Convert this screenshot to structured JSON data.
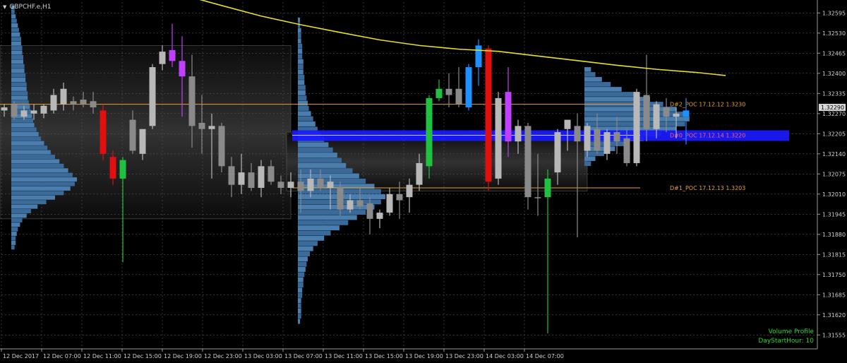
{
  "window": {
    "title": "GBPCHF.e,H1",
    "menu_icon": "triangle-down-icon"
  },
  "info_box": {
    "line1": "Volume Profile",
    "line2": "DayStartHour: 10"
  },
  "chart_data": {
    "type": "candlestick",
    "symbol": "GBPCHF.e",
    "timeframe": "H1",
    "ylim": [
      1.3151,
      1.3263
    ],
    "grid": true,
    "price_ticks": [
      "1.32595",
      "1.32530",
      "1.32465",
      "1.32400",
      "1.32335",
      "1.32270",
      "1.32205",
      "1.32140",
      "1.32075",
      "1.32010",
      "1.31945",
      "1.31880",
      "1.31815",
      "1.31750",
      "1.31685",
      "1.31620",
      "1.31555"
    ],
    "current_price": "1.32290",
    "time_labels": [
      "12 Dec 2017",
      "12 Dec 07:00",
      "12 Dec 11:00",
      "12 Dec 15:00",
      "12 Dec 19:00",
      "12 Dec 23:00",
      "13 Dec 03:00",
      "13 Dec 07:00",
      "13 Dec 11:00",
      "13 Dec 15:00",
      "13 Dec 19:00",
      "13 Dec 23:00",
      "14 Dec 03:00",
      "14 Dec 07:00"
    ],
    "poc_levels": [
      {
        "label": "D#2_POC 17.12.12 1.3230",
        "price": 1.323,
        "color": "#e8a030"
      },
      {
        "label": "D#0_POC 17.12.14 1.3220",
        "price": 1.322,
        "color": "#ff6060"
      },
      {
        "label": "D#1_POC 17.12.13 1.3203",
        "price": 1.3203,
        "color": "#e8a030"
      }
    ],
    "value_areas": [
      {
        "start": 0,
        "end": 29,
        "high": 1.3249,
        "low": 1.3193
      },
      {
        "start": 29,
        "end": 59,
        "high": 1.3221,
        "low": 1.3202
      }
    ],
    "volume_profiles": [
      {
        "anchor": 1,
        "high": 1.3262,
        "low": 1.3183,
        "poc": 1.323,
        "widths": [
          3,
          3,
          4,
          5,
          6,
          7,
          8,
          9,
          9,
          10,
          10,
          11,
          11,
          12,
          12,
          13,
          13,
          14,
          14,
          15,
          15,
          16,
          17,
          18,
          19,
          20,
          21,
          23,
          25,
          27,
          30,
          33,
          36,
          40,
          44,
          48,
          52,
          56,
          60,
          58,
          54,
          48,
          40,
          32,
          24,
          18,
          14,
          10,
          8,
          6,
          5,
          4,
          4,
          3
        ]
      },
      {
        "anchor": 30,
        "high": 1.3258,
        "low": 1.3159,
        "poc": 1.3203,
        "widths": [
          2,
          2,
          3,
          3,
          3,
          4,
          4,
          4,
          5,
          5,
          5,
          6,
          6,
          7,
          7,
          8,
          9,
          10,
          12,
          14,
          16,
          18,
          21,
          24,
          28,
          32,
          36,
          40,
          44,
          50,
          56,
          62,
          70,
          76,
          80,
          76,
          70,
          62,
          54,
          46,
          38,
          30,
          24,
          18,
          14,
          11,
          9,
          8,
          7,
          6,
          5,
          5,
          4,
          4,
          3,
          3,
          3,
          3,
          2
        ]
      },
      {
        "anchor": 59,
        "high": 1.3242,
        "low": 1.321,
        "poc": 1.322,
        "widths": [
          6,
          10,
          16,
          24,
          34,
          46,
          60,
          72,
          84,
          92,
          96,
          92,
          84,
          70,
          54,
          40,
          28,
          18,
          10,
          6
        ]
      }
    ],
    "series": [
      {
        "name": "MA",
        "type": "line",
        "color": "#e8e020"
      },
      {
        "name": "GBPCHF.e",
        "type": "candlestick"
      }
    ],
    "ma_values": [
      [
        14,
        1.32684
      ],
      [
        18,
        1.32654
      ],
      [
        22,
        1.32619
      ],
      [
        26,
        1.32585
      ],
      [
        30,
        1.32557
      ],
      [
        34,
        1.32532
      ],
      [
        38,
        1.32508
      ],
      [
        42,
        1.3249
      ],
      [
        46,
        1.32478
      ],
      [
        50,
        1.32471
      ],
      [
        54,
        1.32456
      ],
      [
        58,
        1.32441
      ],
      [
        62,
        1.32426
      ],
      [
        66,
        1.32413
      ],
      [
        70,
        1.32403
      ],
      [
        73,
        1.32393
      ]
    ],
    "candles": [
      {
        "i": 0,
        "o": 1.3228,
        "h": 1.323,
        "l": 1.3226,
        "c": 1.3229,
        "col": "#b8b8b8"
      },
      {
        "i": 1,
        "o": 1.323,
        "h": 1.3231,
        "l": 1.3225,
        "c": 1.3226,
        "col": "#8a8a8a"
      },
      {
        "i": 2,
        "o": 1.3226,
        "h": 1.32295,
        "l": 1.3225,
        "c": 1.3228,
        "col": "#b8b8b8"
      },
      {
        "i": 3,
        "o": 1.3228,
        "h": 1.323,
        "l": 1.3225,
        "c": 1.3227,
        "col": "#b8b8b8"
      },
      {
        "i": 4,
        "o": 1.3227,
        "h": 1.323,
        "l": 1.32255,
        "c": 1.32295,
        "col": "#b8b8b8"
      },
      {
        "i": 5,
        "o": 1.3228,
        "h": 1.3235,
        "l": 1.3227,
        "c": 1.3233,
        "col": "#b8b8b8"
      },
      {
        "i": 6,
        "o": 1.323,
        "h": 1.3237,
        "l": 1.3228,
        "c": 1.3235,
        "col": "#b8b8b8"
      },
      {
        "i": 7,
        "o": 1.323,
        "h": 1.32325,
        "l": 1.3228,
        "c": 1.3231,
        "col": "#8a8a8a"
      },
      {
        "i": 8,
        "o": 1.32315,
        "h": 1.3234,
        "l": 1.3229,
        "c": 1.323,
        "col": "#8a8a8a"
      },
      {
        "i": 9,
        "o": 1.3231,
        "h": 1.3234,
        "l": 1.3227,
        "c": 1.3229,
        "col": "#8a8a8a"
      },
      {
        "i": 10,
        "o": 1.3228,
        "h": 1.323,
        "l": 1.3212,
        "c": 1.3214,
        "col": "#e01010"
      },
      {
        "i": 11,
        "o": 1.3213,
        "h": 1.3215,
        "l": 1.3204,
        "c": 1.3206,
        "col": "#e01010"
      },
      {
        "i": 12,
        "o": 1.3206,
        "h": 1.3213,
        "l": 1.3179,
        "c": 1.3212,
        "col": "#20c040"
      },
      {
        "i": 13,
        "o": 1.3215,
        "h": 1.3228,
        "l": 1.3214,
        "c": 1.3225,
        "col": "#8a8a8a"
      },
      {
        "i": 14,
        "o": 1.3214,
        "h": 1.3221,
        "l": 1.3212,
        "c": 1.3222,
        "col": "#b8b8b8"
      },
      {
        "i": 15,
        "o": 1.3223,
        "h": 1.3243,
        "l": 1.3222,
        "c": 1.3242,
        "col": "#b8b8b8"
      },
      {
        "i": 16,
        "o": 1.3243,
        "h": 1.3249,
        "l": 1.3241,
        "c": 1.3247,
        "col": "#b8b8b8"
      },
      {
        "i": 17,
        "o": 1.32475,
        "h": 1.3256,
        "l": 1.3242,
        "c": 1.3244,
        "col": "#c040ff"
      },
      {
        "i": 18,
        "o": 1.3244,
        "h": 1.3252,
        "l": 1.3226,
        "c": 1.3239,
        "col": "#c040ff"
      },
      {
        "i": 19,
        "o": 1.3239,
        "h": 1.3246,
        "l": 1.3216,
        "c": 1.3223,
        "col": "#8a8a8a"
      },
      {
        "i": 20,
        "o": 1.3224,
        "h": 1.3233,
        "l": 1.3214,
        "c": 1.3222,
        "col": "#8a8a8a"
      },
      {
        "i": 21,
        "o": 1.3222,
        "h": 1.3227,
        "l": 1.3206,
        "c": 1.3223,
        "col": "#b8b8b8"
      },
      {
        "i": 22,
        "o": 1.3223,
        "h": 1.3224,
        "l": 1.3208,
        "c": 1.321,
        "col": "#8a8a8a"
      },
      {
        "i": 23,
        "o": 1.321,
        "h": 1.3213,
        "l": 1.32,
        "c": 1.3204,
        "col": "#8a8a8a"
      },
      {
        "i": 24,
        "o": 1.3204,
        "h": 1.3214,
        "l": 1.3201,
        "c": 1.3208,
        "col": "#b8b8b8"
      },
      {
        "i": 25,
        "o": 1.3208,
        "h": 1.3211,
        "l": 1.3202,
        "c": 1.3203,
        "col": "#8a8a8a"
      },
      {
        "i": 26,
        "o": 1.3203,
        "h": 1.3212,
        "l": 1.32,
        "c": 1.321,
        "col": "#b8b8b8"
      },
      {
        "i": 27,
        "o": 1.321,
        "h": 1.3212,
        "l": 1.3204,
        "c": 1.3205,
        "col": "#8a8a8a"
      },
      {
        "i": 28,
        "o": 1.3205,
        "h": 1.3207,
        "l": 1.3201,
        "c": 1.3203,
        "col": "#8a8a8a"
      },
      {
        "i": 29,
        "o": 1.3203,
        "h": 1.3208,
        "l": 1.32,
        "c": 1.3205,
        "col": "#b8b8b8"
      },
      {
        "i": 30,
        "o": 1.3205,
        "h": 1.3209,
        "l": 1.3195,
        "c": 1.3202,
        "col": "#8a8a8a"
      },
      {
        "i": 31,
        "o": 1.3202,
        "h": 1.3209,
        "l": 1.32,
        "c": 1.3206,
        "col": "#b8b8b8"
      },
      {
        "i": 32,
        "o": 1.3206,
        "h": 1.3209,
        "l": 1.3202,
        "c": 1.3203,
        "col": "#8a8a8a"
      },
      {
        "i": 33,
        "o": 1.3203,
        "h": 1.3207,
        "l": 1.3196,
        "c": 1.3205,
        "col": "#b8b8b8"
      },
      {
        "i": 34,
        "o": 1.3203,
        "h": 1.3205,
        "l": 1.3194,
        "c": 1.3196,
        "col": "#8a8a8a"
      },
      {
        "i": 35,
        "o": 1.3196,
        "h": 1.3201,
        "l": 1.3195,
        "c": 1.3199,
        "col": "#b8b8b8"
      },
      {
        "i": 36,
        "o": 1.3199,
        "h": 1.3203,
        "l": 1.3196,
        "c": 1.3197,
        "col": "#8a8a8a"
      },
      {
        "i": 37,
        "o": 1.3198,
        "h": 1.32,
        "l": 1.3188,
        "c": 1.3193,
        "col": "#8a8a8a"
      },
      {
        "i": 38,
        "o": 1.3193,
        "h": 1.3196,
        "l": 1.319,
        "c": 1.3195,
        "col": "#b8b8b8"
      },
      {
        "i": 39,
        "o": 1.3195,
        "h": 1.3203,
        "l": 1.3194,
        "c": 1.3201,
        "col": "#b8b8b8"
      },
      {
        "i": 40,
        "o": 1.3201,
        "h": 1.3205,
        "l": 1.3193,
        "c": 1.3199,
        "col": "#8a8a8a"
      },
      {
        "i": 41,
        "o": 1.32,
        "h": 1.3206,
        "l": 1.3195,
        "c": 1.3204,
        "col": "#b8b8b8"
      },
      {
        "i": 42,
        "o": 1.3204,
        "h": 1.3214,
        "l": 1.3202,
        "c": 1.3211,
        "col": "#b8b8b8"
      },
      {
        "i": 43,
        "o": 1.321,
        "h": 1.3233,
        "l": 1.3206,
        "c": 1.3232,
        "col": "#20c040"
      },
      {
        "i": 44,
        "o": 1.3232,
        "h": 1.3238,
        "l": 1.3231,
        "c": 1.3235,
        "col": "#20c040"
      },
      {
        "i": 45,
        "o": 1.3233,
        "h": 1.324,
        "l": 1.3229,
        "c": 1.3235,
        "col": "#8a8a8a"
      },
      {
        "i": 46,
        "o": 1.3235,
        "h": 1.3242,
        "l": 1.3229,
        "c": 1.323,
        "col": "#8a8a8a"
      },
      {
        "i": 47,
        "o": 1.3229,
        "h": 1.3243,
        "l": 1.3228,
        "c": 1.3242,
        "col": "#1e90ff"
      },
      {
        "i": 48,
        "o": 1.3242,
        "h": 1.3251,
        "l": 1.3236,
        "c": 1.3249,
        "col": "#1e90ff"
      },
      {
        "i": 49,
        "o": 1.3248,
        "h": 1.3249,
        "l": 1.3202,
        "c": 1.3205,
        "col": "#e01010"
      },
      {
        "i": 50,
        "o": 1.3206,
        "h": 1.3234,
        "l": 1.3204,
        "c": 1.3232,
        "col": "#b8b8b8"
      },
      {
        "i": 51,
        "o": 1.3234,
        "h": 1.3242,
        "l": 1.3213,
        "c": 1.3218,
        "col": "#c040ff"
      },
      {
        "i": 52,
        "o": 1.3218,
        "h": 1.3225,
        "l": 1.3214,
        "c": 1.3223,
        "col": "#b8b8b8"
      },
      {
        "i": 53,
        "o": 1.3223,
        "h": 1.3224,
        "l": 1.3196,
        "c": 1.32,
        "col": "#8a8a8a"
      },
      {
        "i": 54,
        "o": 1.32,
        "h": 1.3214,
        "l": 1.3194,
        "c": 1.32,
        "col": "#8a8a8a"
      },
      {
        "i": 55,
        "o": 1.32,
        "h": 1.3209,
        "l": 1.3156,
        "c": 1.3206,
        "col": "#20c040"
      },
      {
        "i": 56,
        "o": 1.3208,
        "h": 1.3222,
        "l": 1.3204,
        "c": 1.3221,
        "col": "#b8b8b8"
      },
      {
        "i": 57,
        "o": 1.3222,
        "h": 1.3225,
        "l": 1.3215,
        "c": 1.3225,
        "col": "#b8b8b8"
      },
      {
        "i": 58,
        "o": 1.3223,
        "h": 1.3227,
        "l": 1.3187,
        "c": 1.3218,
        "col": "#8a8a8a"
      },
      {
        "i": 59,
        "o": 1.3215,
        "h": 1.3224,
        "l": 1.3213,
        "c": 1.3223,
        "col": "#b8b8b8"
      },
      {
        "i": 60,
        "o": 1.3222,
        "h": 1.3227,
        "l": 1.3214,
        "c": 1.3215,
        "col": "#8a8a8a"
      },
      {
        "i": 61,
        "o": 1.3214,
        "h": 1.3222,
        "l": 1.3212,
        "c": 1.3221,
        "col": "#b8b8b8"
      },
      {
        "i": 62,
        "o": 1.3221,
        "h": 1.3226,
        "l": 1.3214,
        "c": 1.3218,
        "col": "#8a8a8a"
      },
      {
        "i": 63,
        "o": 1.3219,
        "h": 1.3222,
        "l": 1.321,
        "c": 1.3211,
        "col": "#8a8a8a"
      },
      {
        "i": 64,
        "o": 1.3211,
        "h": 1.3235,
        "l": 1.321,
        "c": 1.3234,
        "col": "#b8b8b8"
      },
      {
        "i": 65,
        "o": 1.3233,
        "h": 1.3246,
        "l": 1.3218,
        "c": 1.3222,
        "col": "#8a8a8a"
      },
      {
        "i": 66,
        "o": 1.3222,
        "h": 1.3231,
        "l": 1.3219,
        "c": 1.323,
        "col": "#b8b8b8"
      },
      {
        "i": 67,
        "o": 1.3229,
        "h": 1.3232,
        "l": 1.3221,
        "c": 1.3226,
        "col": "#8a8a8a"
      },
      {
        "i": 68,
        "o": 1.3226,
        "h": 1.3229,
        "l": 1.3219,
        "c": 1.3227,
        "col": "#b8b8b8"
      },
      {
        "i": 69,
        "o": 1.3226,
        "h": 1.3232,
        "l": 1.3217,
        "c": 1.3228,
        "col": "#1e90ff"
      }
    ]
  }
}
